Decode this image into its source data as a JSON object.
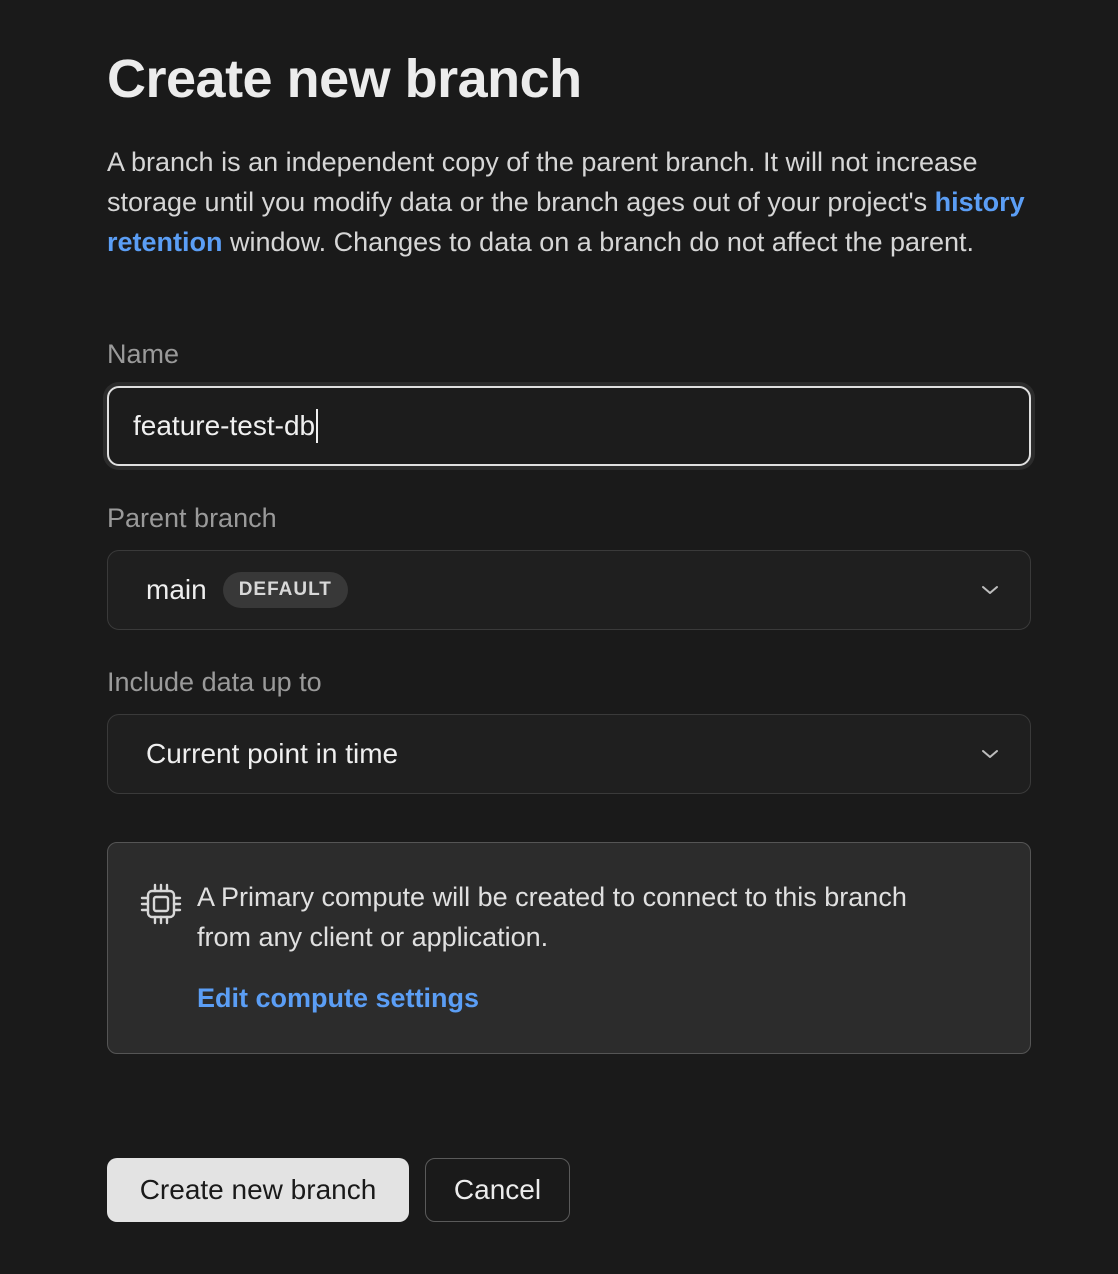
{
  "title": "Create new branch",
  "description": {
    "before_link": "A branch is an independent copy of the parent branch. It will not increase storage until you modify data or the branch ages out of your project's ",
    "link": "history retention",
    "after_link": " window. Changes to data on a branch do not affect the parent."
  },
  "name": {
    "label": "Name",
    "value": "feature-test-db"
  },
  "parent_branch": {
    "label": "Parent branch",
    "value": "main",
    "badge": "DEFAULT",
    "icon": "chevron-down-icon"
  },
  "include_data": {
    "label": "Include data up to",
    "value": "Current point in time",
    "icon": "chevron-down-icon"
  },
  "notice": {
    "icon": "chip-icon",
    "text": "A Primary compute will be created to connect to this branch from any client or application.",
    "link": "Edit compute settings"
  },
  "actions": {
    "create_label": "Create new branch",
    "cancel_label": "Cancel"
  },
  "colors": {
    "background": "#1a1a1a",
    "link": "#5b9ef5",
    "primary_button": "#e3e3e3"
  }
}
